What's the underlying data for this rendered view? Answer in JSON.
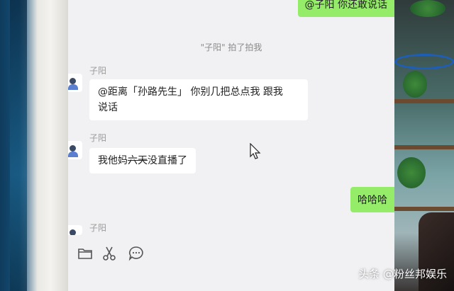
{
  "chat": {
    "top_me_bubble": "@子阳 你还敢说话",
    "system_message": "\"子阳\" 拍了拍我",
    "messages": [
      {
        "sender": "子阳",
        "line1": "@距离「孙路先生」 你别几把总点我 跟我",
        "line2": "说话"
      },
      {
        "sender": "子阳",
        "text_before": "我他妈",
        "text_struck": "六天",
        "text_after": "没直播了"
      },
      {
        "sender": "子阳"
      }
    ],
    "me_bubble_2": "哈哈哈"
  },
  "toolbar": {
    "icons": [
      "folder-icon",
      "scissors-icon",
      "emoji-icon"
    ]
  },
  "watermark": "头条 @粉丝邦娱乐",
  "colors": {
    "my_bubble": "#95ec69",
    "their_bubble": "#ffffff",
    "chat_bg": "#f1f1f3"
  }
}
